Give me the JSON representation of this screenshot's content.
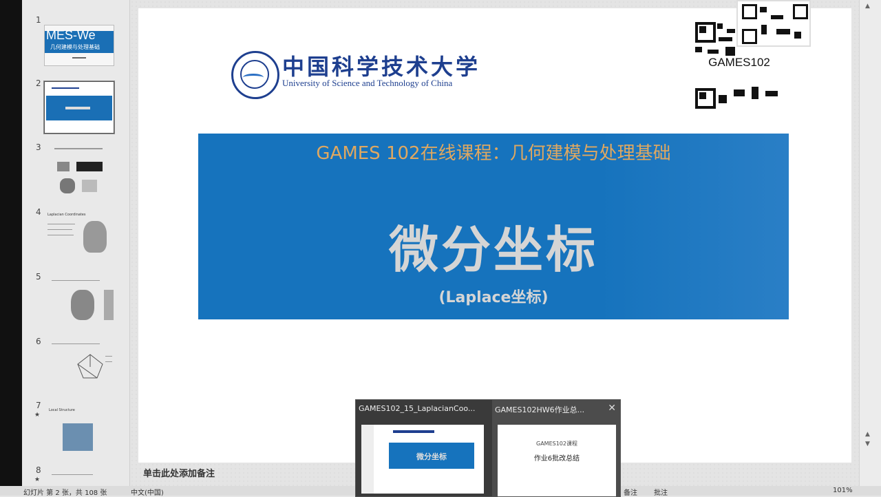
{
  "thumbnails": [
    {
      "num": "1",
      "top_text": "MES-We",
      "mid_text": "几何建模与处理基础"
    },
    {
      "num": "2"
    },
    {
      "num": "3"
    },
    {
      "num": "4",
      "text": "Laplacian Coordinates"
    },
    {
      "num": "5"
    },
    {
      "num": "6"
    },
    {
      "num": "7",
      "text": "Local Structure"
    },
    {
      "num": "8"
    }
  ],
  "slide": {
    "university_cn": "中国科学技术大学",
    "university_en": "University of Science and Technology of China",
    "qr_label": "GAMES102",
    "course_title": "GAMES 102在线课程：几何建模与处理基础",
    "main_title": "微分坐标",
    "subtitle": "(Laplace坐标)"
  },
  "notes_placeholder": "单击此处添加备注",
  "taskbar_preview": {
    "items": [
      {
        "title": "GAMES102_15_LaplacianCoo...",
        "mini_title": "微分坐标"
      },
      {
        "title": "GAMES102HW6作业总...",
        "mini_header": "GAMES102课程",
        "mini_title": "作业6批改总结"
      }
    ]
  },
  "statusbar": {
    "slide_info": "幻灯片 第 2 张，共 108 张",
    "language": "中文(中国)",
    "notes_btn": "备注",
    "comments_btn": "批注",
    "zoom": "101%"
  },
  "colors": {
    "banner_blue": "#1673bd",
    "course_orange": "#e0a860",
    "ustc_blue": "#1e3f8f"
  }
}
